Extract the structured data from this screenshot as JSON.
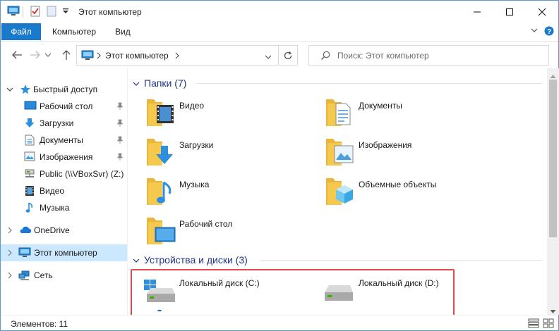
{
  "window": {
    "title": "Этот компьютер"
  },
  "ribbon": {
    "tabs": [
      "Файл",
      "Компьютер",
      "Вид"
    ]
  },
  "address": {
    "path": "Этот компьютер",
    "search_placeholder": "Поиск: Этот компьютер"
  },
  "nav": {
    "quick_access": "Быстрый доступ",
    "quick_items": [
      {
        "label": "Рабочий стол",
        "icon": "desktop-icon",
        "pinned": true
      },
      {
        "label": "Загрузки",
        "icon": "downloads-icon",
        "pinned": true
      },
      {
        "label": "Документы",
        "icon": "documents-icon",
        "pinned": true
      },
      {
        "label": "Изображения",
        "icon": "pictures-icon",
        "pinned": true
      },
      {
        "label": "Public (\\\\VBoxSvr) (Z:)",
        "icon": "network-drive-icon",
        "pinned": false
      },
      {
        "label": "Видео",
        "icon": "video-icon",
        "pinned": false
      },
      {
        "label": "Музыка",
        "icon": "music-icon",
        "pinned": false
      }
    ],
    "onedrive": "OneDrive",
    "this_pc": "Этот компьютер",
    "network": "Сеть"
  },
  "content": {
    "folders_header": "Папки (7)",
    "folders": [
      {
        "label": "Видео",
        "icon": "video-folder-icon"
      },
      {
        "label": "Документы",
        "icon": "documents-folder-icon"
      },
      {
        "label": "Загрузки",
        "icon": "downloads-folder-icon"
      },
      {
        "label": "Изображения",
        "icon": "pictures-folder-icon"
      },
      {
        "label": "Музыка",
        "icon": "music-folder-icon"
      },
      {
        "label": "Объемные объекты",
        "icon": "3d-objects-folder-icon"
      },
      {
        "label": "Рабочий стол",
        "icon": "desktop-folder-icon"
      }
    ],
    "devices_header": "Устройства и диски (3)",
    "devices": [
      {
        "label": "Локальный диск (C:)",
        "icon": "system-drive-icon"
      },
      {
        "label": "Локальный диск (D:)",
        "icon": "hard-drive-icon"
      }
    ]
  },
  "status": {
    "items_text": "Элементов: 11"
  },
  "colors": {
    "accent": "#1979ca",
    "selection": "#cce8ff",
    "group_header": "#1e3287",
    "highlight": "#e8474d",
    "folder": "#f5c94d"
  }
}
